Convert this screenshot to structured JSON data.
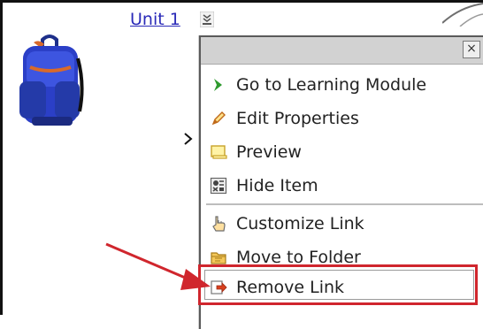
{
  "unit": {
    "link_label": "Unit 1",
    "menu_icon": "chevron-menu-icon"
  },
  "menu": {
    "close_label": "×",
    "items": [
      {
        "label": "Go to Learning Module",
        "icon": "green-arrow-icon"
      },
      {
        "label": "Edit Properties",
        "icon": "pencil-icon"
      },
      {
        "label": "Preview",
        "icon": "preview-window-icon"
      },
      {
        "label": "Hide Item",
        "icon": "hide-item-icon"
      },
      {
        "label": "Customize Link",
        "icon": "hand-pointer-icon"
      },
      {
        "label": "Move to Folder",
        "icon": "folder-icon"
      },
      {
        "label": "Remove Link",
        "icon": "remove-link-icon"
      }
    ]
  },
  "colors": {
    "link": "#2a2ab8",
    "highlight": "#d0262d",
    "annotation_arrow": "#d0262d"
  }
}
